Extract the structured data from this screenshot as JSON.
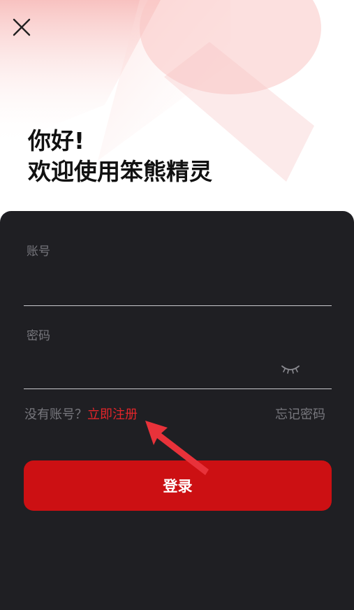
{
  "header": {
    "close_icon": "close-icon"
  },
  "greeting": {
    "line1": "你好!",
    "line2": "欢迎使用笨熊精灵"
  },
  "form": {
    "account_label": "账号",
    "account_value": "",
    "password_label": "密码",
    "password_value": "",
    "password_toggle_icon": "eye-closed-icon"
  },
  "links": {
    "no_account_text": "没有账号？",
    "register_label": "立即注册",
    "forgot_label": "忘记密码"
  },
  "actions": {
    "login_label": "登录"
  },
  "colors": {
    "accent": "#cc1013",
    "link_red": "#e3252a",
    "panel_bg": "#1f1f23",
    "annotation_arrow": "#e8323a"
  }
}
